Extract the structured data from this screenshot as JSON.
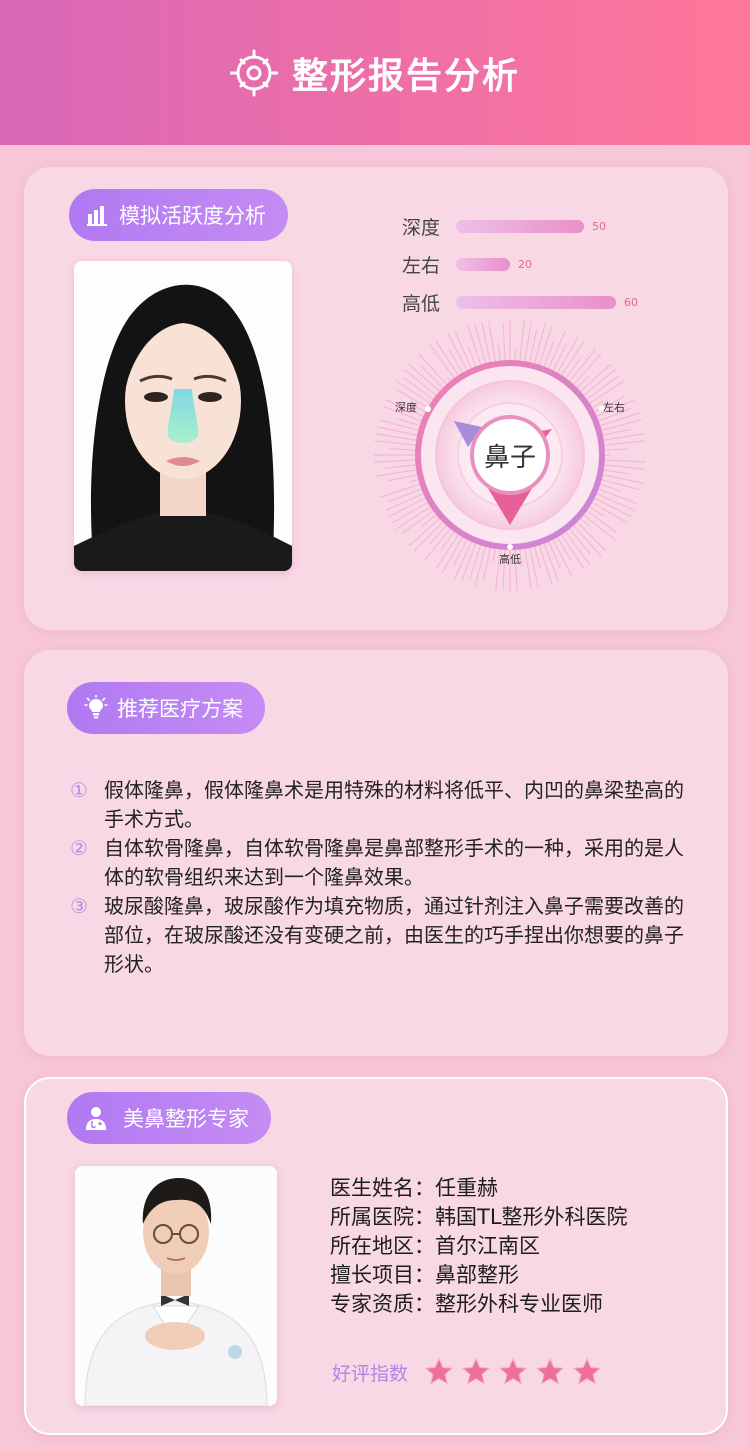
{
  "header": {
    "title": "整形报告分析",
    "icon": "face-scan-icon"
  },
  "analysis": {
    "pill_label": "模拟活跃度分析",
    "pill_icon": "bar-chart-icon",
    "metrics": [
      {
        "label": "深度",
        "value": 50
      },
      {
        "label": "左右",
        "value": 20
      },
      {
        "label": "高低",
        "value": 60
      }
    ],
    "radar": {
      "center_label": "鼻子",
      "label_left": "深度",
      "label_right": "左右",
      "label_bottom": "高低"
    },
    "colors": {
      "accent": "#e8609a",
      "purple": "#b079f2"
    }
  },
  "plan": {
    "pill_label": "推荐医疗方案",
    "pill_icon": "lightbulb-icon",
    "items": [
      {
        "num": "①",
        "text": "假体隆鼻，假体隆鼻术是用特殊的材料将低平、内凹的鼻梁垫高的手术方式。"
      },
      {
        "num": "②",
        "text": "自体软骨隆鼻，自体软骨隆鼻是鼻部整形手术的一种，采用的是人体的软骨组织来达到一个隆鼻效果。"
      },
      {
        "num": "③",
        "text": "玻尿酸隆鼻，玻尿酸作为填充物质，通过针剂注入鼻子需要改善的部位，在玻尿酸还没有变硬之前，由医生的巧手捏出你想要的鼻子形状。"
      }
    ]
  },
  "expert": {
    "pill_label": "美鼻整形专家",
    "pill_icon": "doctor-icon",
    "fields": [
      {
        "label": "医生姓名：",
        "value": "任重赫"
      },
      {
        "label": "所属医院：",
        "value": "韩国TL整形外科医院"
      },
      {
        "label": "所在地区：",
        "value": "首尔江南区"
      },
      {
        "label": "擅长项目：",
        "value": "鼻部整形"
      },
      {
        "label": "专家资质：",
        "value": "整形外科专业医师"
      }
    ],
    "rating_label": "好评指数",
    "rating_stars": 5
  }
}
